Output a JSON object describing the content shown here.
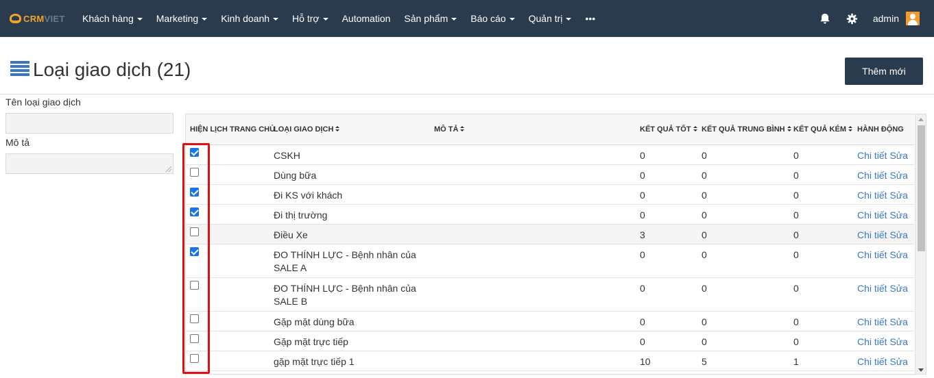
{
  "nav": {
    "logo_crm": "CRM",
    "logo_viet": "VIET",
    "items": [
      {
        "label": "Khách hàng",
        "caret": true
      },
      {
        "label": "Marketing",
        "caret": true
      },
      {
        "label": "Kinh doanh",
        "caret": true
      },
      {
        "label": "Hỗ trợ",
        "caret": true
      },
      {
        "label": "Automation",
        "caret": false
      },
      {
        "label": "Sản phẩm",
        "caret": true
      },
      {
        "label": "Báo cáo",
        "caret": true
      },
      {
        "label": "Quản trị",
        "caret": true
      },
      {
        "label": "•••",
        "caret": false
      }
    ],
    "user": "admin",
    "icons": [
      "bell-icon",
      "gear-icon",
      "user-avatar-icon"
    ],
    "colors": {
      "bar": "#2b3b4e",
      "logo_accent": "#f0a429",
      "avatar": "#f39a2b"
    }
  },
  "header": {
    "title": "Loại giao dịch (21)",
    "add_button": "Thêm mới"
  },
  "filter": {
    "name_label": "Tên loại giao dịch",
    "name_value": "",
    "desc_label": "Mô tả",
    "desc_value": ""
  },
  "table": {
    "columns": [
      {
        "label": "Hiện lịch trang chủ",
        "sortable": false
      },
      {
        "label": "Loại giao dịch",
        "sortable": true
      },
      {
        "label": "Mô tả",
        "sortable": true
      },
      {
        "label": "Kết quả tốt",
        "sortable": true
      },
      {
        "label": "Kết quả trung bình",
        "sortable": true
      },
      {
        "label": "Kết quả kém",
        "sortable": true
      },
      {
        "label": "Hành động",
        "sortable": false
      }
    ],
    "action_detail": "Chi tiết",
    "action_edit": "Sửa",
    "rows": [
      {
        "checked": true,
        "name": "CSKH",
        "desc": "",
        "good": "0",
        "avg": "0",
        "bad": "0"
      },
      {
        "checked": false,
        "name": "Dùng bữa",
        "desc": "",
        "good": "0",
        "avg": "0",
        "bad": "0"
      },
      {
        "checked": true,
        "name": "Đi KS với khách",
        "desc": "",
        "good": "0",
        "avg": "0",
        "bad": "0"
      },
      {
        "checked": true,
        "name": "Đi thị trường",
        "desc": "",
        "good": "0",
        "avg": "0",
        "bad": "0"
      },
      {
        "checked": false,
        "name": "Điều Xe",
        "desc": "",
        "good": "3",
        "avg": "0",
        "bad": "0"
      },
      {
        "checked": true,
        "name_line1": "ĐO THÍNH LỰC - Bệnh nhân của",
        "name_line2": "SALE A",
        "desc": "",
        "good": "0",
        "avg": "0",
        "bad": "0"
      },
      {
        "checked": false,
        "name_line1": "ĐO THÍNH LỰC - Bệnh nhân của",
        "name_line2": "SALE B",
        "desc": "",
        "good": "0",
        "avg": "0",
        "bad": "0"
      },
      {
        "checked": false,
        "name": "Gặp mặt dùng bữa",
        "desc": "",
        "good": "0",
        "avg": "0",
        "bad": "0"
      },
      {
        "checked": false,
        "name": "Gặp mặt trực tiếp",
        "desc": "",
        "good": "0",
        "avg": "0",
        "bad": "0"
      },
      {
        "checked": false,
        "name": "gặp mặt trực tiếp 1",
        "desc": "",
        "good": "10",
        "avg": "5",
        "bad": "1"
      }
    ],
    "link_color": "#3a78c3",
    "highlight_color": "#e01010"
  }
}
